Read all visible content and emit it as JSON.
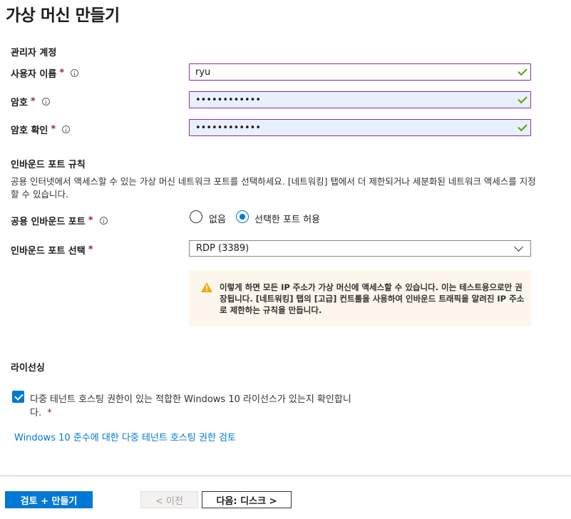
{
  "page": {
    "title": "가상 머신 만들기"
  },
  "admin": {
    "section_title": "관리자 계정",
    "username": {
      "label": "사용자 이름",
      "required": "*",
      "value": "ryu"
    },
    "password": {
      "label": "암호",
      "required": "*",
      "value": "••••••••••••"
    },
    "confirm_password": {
      "label": "암호 확인",
      "required": "*",
      "value": "••••••••••••"
    }
  },
  "inbound": {
    "section_title": "인바운드 포트 규칙",
    "description": "공용 인터넷에서 액세스할 수 있는 가상 머신 네트워크 포트를 선택하세요. [네트워킹] 탭에서 더 제한되거나 세분화된 네트워크 액세스를 지정할 수 있습니다.",
    "public_ports": {
      "label": "공용 인바운드 포트",
      "required": "*",
      "options": [
        "없음",
        "선택한 포트 허용"
      ],
      "selected": "선택한 포트 허용"
    },
    "select_ports": {
      "label": "인바운드 포트 선택",
      "required": "*",
      "value": "RDP (3389)"
    },
    "warning": "이렇게 하면 모든 IP 주소가 가상 머신에 액세스할 수 있습니다.  이는 테스트용으로만 권장됩니다.  [네트워킹] 탭의 [고급] 컨트롤을 사용하여 인바운드 트래픽을 알려진 IP 주소로 제한하는 규칙을 만듭니다."
  },
  "licensing": {
    "section_title": "라이선싱",
    "confirm_label": "다중 테넌트 호스팅 권한이 있는 적합한 Windows 10 라이선스가 있는지 확인합니다.",
    "required": "*",
    "checked": true,
    "link_text": "Windows 10 준수에 대한 다중 테넌트 호스팅 권한 검토"
  },
  "footer": {
    "review_create": "검토 + 만들기",
    "previous": "< 이전",
    "next": "다음: 디스크 >"
  },
  "colors": {
    "accent": "#0078d4",
    "input_border": "#8a2da5",
    "valid_check": "#57a300",
    "required": "#a4262c",
    "warning": "#f7a707"
  }
}
